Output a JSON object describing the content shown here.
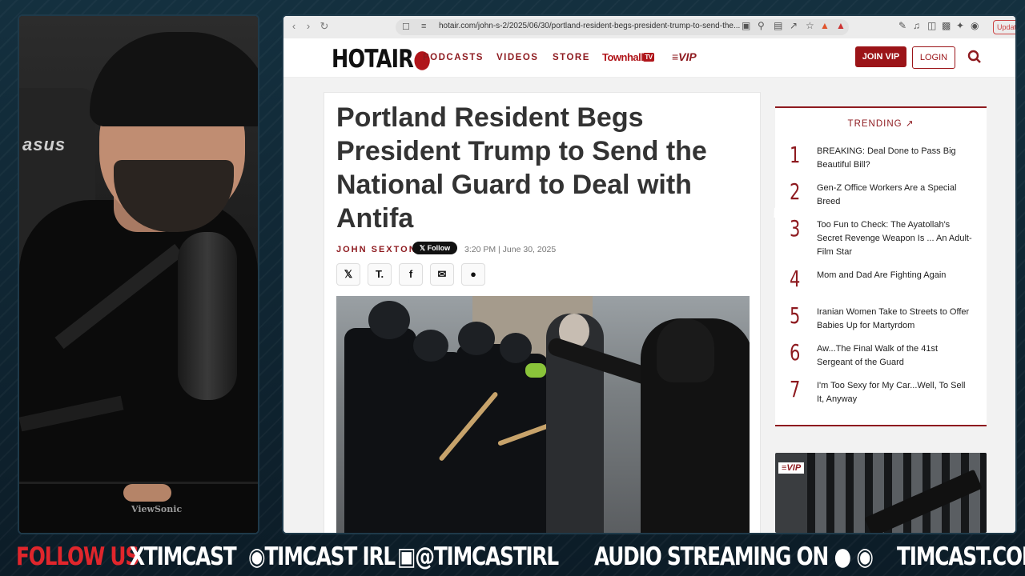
{
  "browser": {
    "url": "hotair.com/john-s-2/2025/06/30/portland-resident-begs-president-trump-to-send-the...",
    "update_label": "Updat"
  },
  "site": {
    "logo_hot": "HOT",
    "logo_air": "AIR",
    "nav": [
      "PODCASTS",
      "VIDEOS",
      "STORE"
    ],
    "townhall": "Townhall",
    "townhall_tv": "TV",
    "vip": "VIP",
    "join": "JOIN VIP",
    "login": "LOGIN"
  },
  "article": {
    "headline": "Portland Resident Begs President Trump to Send the National Guard to Deal with Antifa",
    "author": "JOHN SEXTON",
    "follow": "Follow",
    "dateline": "3:20 PM | June 30, 2025"
  },
  "trending": {
    "title": "TRENDING",
    "items": [
      {
        "num": "1",
        "text": "BREAKING: Deal Done to Pass Big Beautiful Bill?"
      },
      {
        "num": "2",
        "text": "Gen-Z Office Workers Are a Special Breed"
      },
      {
        "num": "3",
        "text": "Too Fun to Check: The Ayatollah's Secret Revenge Weapon Is ... An Adult-Film Star"
      },
      {
        "num": "4",
        "text": "Mom and Dad Are Fighting Again"
      },
      {
        "num": "5",
        "text": "Iranian Women Take to Streets to Offer Babies Up for Martyrdom"
      },
      {
        "num": "6",
        "text": "Aw...The Final Walk of the 41st Sergeant of the Guard"
      },
      {
        "num": "7",
        "text": "I'm Too Sexy for My Car...Well, To Sell It, Anyway"
      }
    ],
    "vip_tag": "VIP"
  },
  "webcam": {
    "chair_logo": "asus",
    "monitor_brand": "ViewSonic"
  },
  "ticker": {
    "follow_us": "FOLLOW US",
    "x_handle": "TIMCAST",
    "fb_handle": "TIMCAST IRL",
    "ig_handle": "@TIMCASTIRL",
    "audio": "AUDIO STREAMING ON",
    "site": "TIMCAST.COM"
  },
  "colors": {
    "brand_red": "#8e1a1f",
    "ticker_red": "#e0262c",
    "background": "#0d1d28"
  }
}
